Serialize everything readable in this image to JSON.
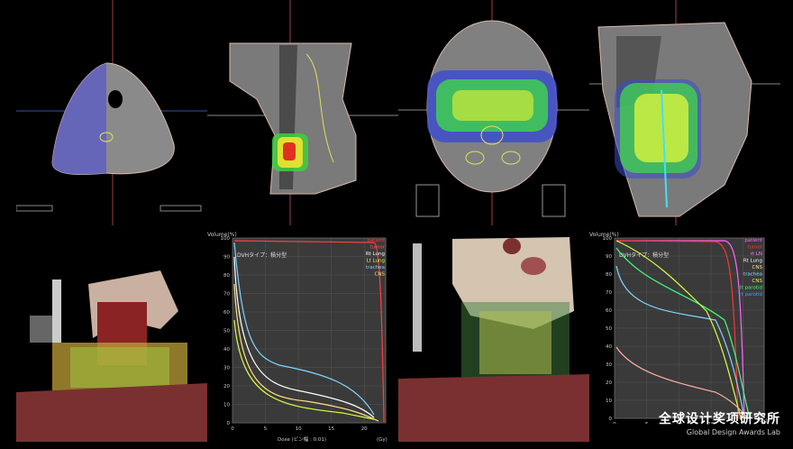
{
  "dvh_left": {
    "volume_label": "Volume(%)",
    "type_label": "DVHタイプ：積分型",
    "xlabel": "Dose (ビン幅 : 0.01)",
    "unit": "(Gy)",
    "legend": [
      {
        "name": "patient",
        "color": "#ff3b3b"
      },
      {
        "name": "tumor",
        "color": "#ff5555"
      },
      {
        "name": "Rt Lung",
        "color": "#ffffff"
      },
      {
        "name": "Lt Lung",
        "color": "#d8ff40"
      },
      {
        "name": "trachea",
        "color": "#7fd7ff"
      },
      {
        "name": "CNS",
        "color": "#ffe080"
      }
    ],
    "y_ticks": [
      "0",
      "10",
      "20",
      "30",
      "40",
      "50",
      "60",
      "70",
      "80",
      "90",
      "100"
    ],
    "x_ticks": [
      "0",
      "5",
      "10",
      "15",
      "20"
    ]
  },
  "dvh_right": {
    "volume_label": "Volume(%)",
    "type_label": "DVHタイプ：積分型",
    "unit": "(Gy)",
    "legend": [
      {
        "name": "patient",
        "color": "#ff66ff"
      },
      {
        "name": "tumor",
        "color": "#ff3333"
      },
      {
        "name": "rt LN",
        "color": "#ff80ff"
      },
      {
        "name": "Rt Lung",
        "color": "#ffffff"
      },
      {
        "name": "CNS",
        "color": "#ffe080"
      },
      {
        "name": "trachea",
        "color": "#7fd7ff"
      },
      {
        "name": "CNS",
        "color": "#d8ff40"
      },
      {
        "name": "lt parotid",
        "color": "#40ff80"
      },
      {
        "name": "rt parotid",
        "color": "#40a0ff"
      }
    ],
    "y_ticks": [
      "0",
      "10",
      "20",
      "30",
      "40",
      "50",
      "60",
      "70",
      "80",
      "90",
      "100"
    ],
    "x_ticks": [
      "0",
      "5",
      "10",
      "15",
      "20"
    ]
  },
  "watermark": {
    "cn": "全球设计奖项研究所",
    "en": "Global Design Awards Lab"
  }
}
